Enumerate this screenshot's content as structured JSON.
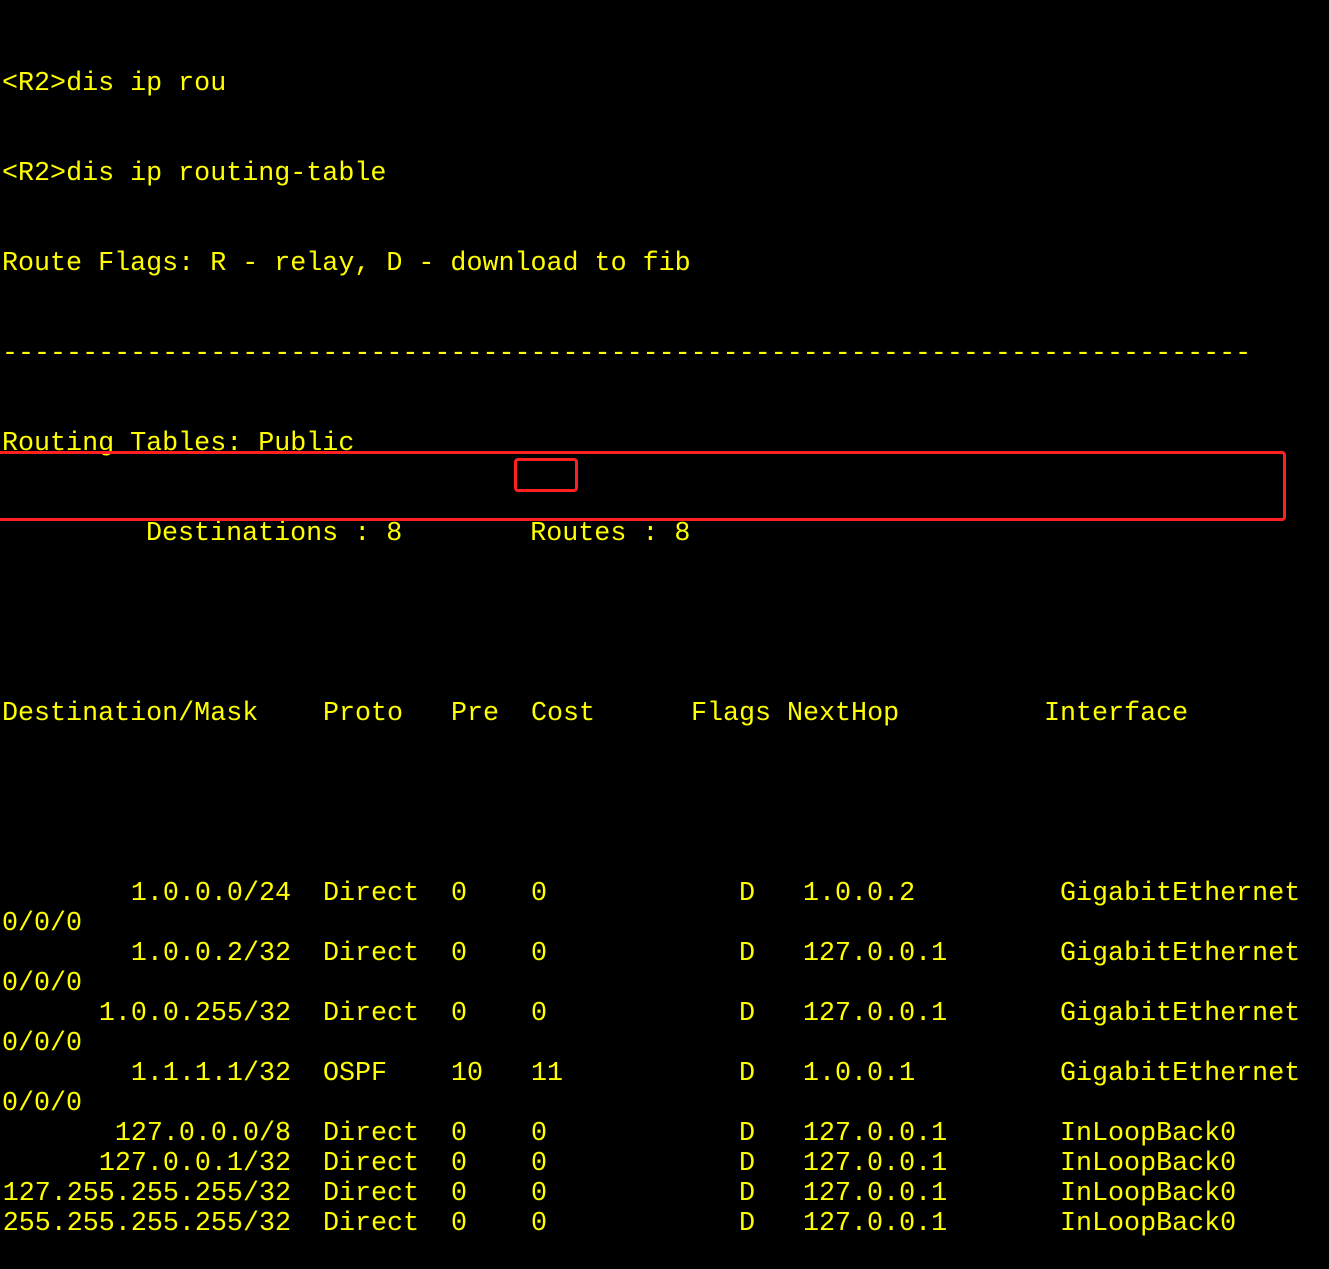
{
  "terminal": {
    "prompt": "<R2>",
    "commands": [
      "dis ip rou",
      "dis ip routing-table"
    ],
    "flags_legend": "Route Flags: R - relay, D - download to fib",
    "separator": "------------------------------------------------------------------------------",
    "table_title": "Routing Tables: Public",
    "summary": {
      "destinations_label": "Destinations : 8",
      "routes_label": "Routes : 8"
    },
    "headers": {
      "destination": "Destination/Mask",
      "proto": "Proto",
      "pre": "Pre",
      "cost": "Cost",
      "flags": "Flags",
      "nexthop": "NextHop",
      "interface": "Interface"
    },
    "routes": [
      {
        "destination": "1.0.0.0/24",
        "proto": "Direct",
        "pre": "0",
        "cost": "0",
        "flags": "D",
        "nexthop": "1.0.0.2",
        "interface": "GigabitEthernet",
        "interface_cont": "0/0/0"
      },
      {
        "destination": "1.0.0.2/32",
        "proto": "Direct",
        "pre": "0",
        "cost": "0",
        "flags": "D",
        "nexthop": "127.0.0.1",
        "interface": "GigabitEthernet",
        "interface_cont": "0/0/0"
      },
      {
        "destination": "1.0.0.255/32",
        "proto": "Direct",
        "pre": "0",
        "cost": "0",
        "flags": "D",
        "nexthop": "127.0.0.1",
        "interface": "GigabitEthernet",
        "interface_cont": "0/0/0"
      },
      {
        "destination": "1.1.1.1/32",
        "proto": "OSPF",
        "pre": "10",
        "cost": "11",
        "flags": "D",
        "nexthop": "1.0.0.1",
        "interface": "GigabitEthernet",
        "interface_cont": "0/0/0",
        "highlighted": true
      },
      {
        "destination": "127.0.0.0/8",
        "proto": "Direct",
        "pre": "0",
        "cost": "0",
        "flags": "D",
        "nexthop": "127.0.0.1",
        "interface": "InLoopBack0"
      },
      {
        "destination": "127.0.0.1/32",
        "proto": "Direct",
        "pre": "0",
        "cost": "0",
        "flags": "D",
        "nexthop": "127.0.0.1",
        "interface": "InLoopBack0"
      },
      {
        "destination": "127.255.255.255/32",
        "proto": "Direct",
        "pre": "0",
        "cost": "0",
        "flags": "D",
        "nexthop": "127.0.0.1",
        "interface": "InLoopBack0"
      },
      {
        "destination": "255.255.255.255/32",
        "proto": "Direct",
        "pre": "0",
        "cost": "0",
        "flags": "D",
        "nexthop": "127.0.0.1",
        "interface": "InLoopBack0"
      }
    ],
    "colors": {
      "background": "#000000",
      "text": "#ffff00",
      "highlight": "#ff2020"
    }
  }
}
